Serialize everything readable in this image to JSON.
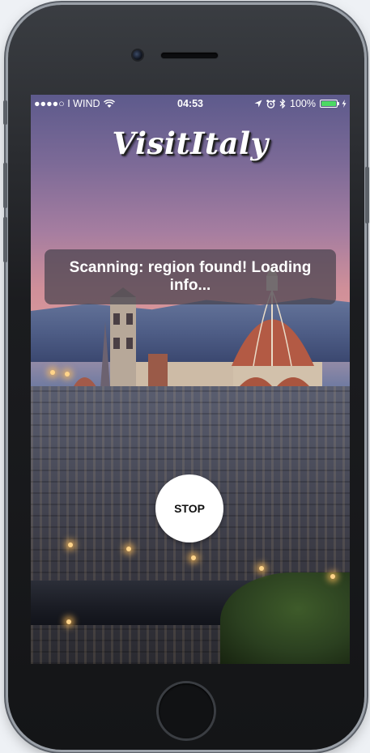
{
  "status_bar": {
    "carrier": "●●●●○ I WIND",
    "wifi_icon": "wifi-icon",
    "time": "04:53",
    "location_icon": "location-arrow-icon",
    "alarm_icon": "alarm-clock-icon",
    "bluetooth_icon": "bluetooth-icon",
    "battery_percent": "100%",
    "battery_level": 1.0,
    "charging_icon": "charging-bolt-icon"
  },
  "app": {
    "title": "VisitItaly",
    "scan_message": "Scanning: region found! Loading info...",
    "stop_label": "STOP"
  },
  "colors": {
    "battery_fill": "#4cd964",
    "toast_background": "rgba(70,66,78,0.72)",
    "button_background": "#ffffff"
  }
}
